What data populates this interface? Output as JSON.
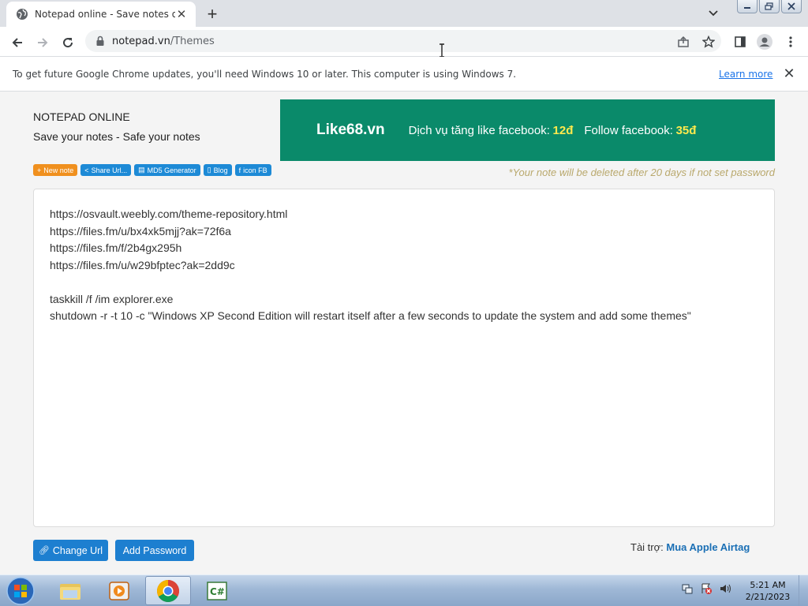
{
  "browser": {
    "tab_title": "Notepad online - Save notes onl",
    "url_host": "notepad.vn",
    "url_path": "/Themes"
  },
  "infobar": {
    "message": "To get future Google Chrome updates, you'll need Windows 10 or later. This computer is using Windows 7.",
    "link": "Learn more"
  },
  "site": {
    "title": "NOTEPAD ONLINE",
    "slogan": "Save your notes - Safe your notes"
  },
  "ad": {
    "brand": "Like68.vn",
    "text1": "Dịch vụ tăng like facebook: ",
    "price1": "12đ",
    "text2": "Follow facebook: ",
    "price2": "35đ",
    "bg_color": "#0a8a6a",
    "highlight_color": "#ffe94d"
  },
  "toolbar_links": [
    {
      "icon": "+",
      "label": "New note"
    },
    {
      "icon": "<",
      "label": "Share Url..."
    },
    {
      "icon": "▤",
      "label": "MD5 Generator"
    },
    {
      "icon": "▯",
      "label": "Blog"
    },
    {
      "icon": "f",
      "label": "icon FB"
    }
  ],
  "notice": "*Your note will be deleted after 20 days if not set password",
  "note": {
    "lines": [
      "https://osvault.weebly.com/theme-repository.html",
      "https://files.fm/u/bx4xk5mjj?ak=72f6a",
      "https://files.fm/f/2b4gx295h",
      "https://files.fm/u/w29bfptec?ak=2dd9c",
      "",
      "taskkill /f /im explorer.exe",
      "shutdown -r -t 10 -c \"Windows XP Second Edition will restart itself after a few seconds to update the system and add some themes\""
    ]
  },
  "buttons": {
    "change_url": "Change Url",
    "add_password": "Add Password"
  },
  "sponsor": {
    "label": "Tài trợ: ",
    "link": "Mua Apple Airtag"
  },
  "taskbar": {
    "time": "5:21 AM",
    "date": "2/21/2023"
  }
}
